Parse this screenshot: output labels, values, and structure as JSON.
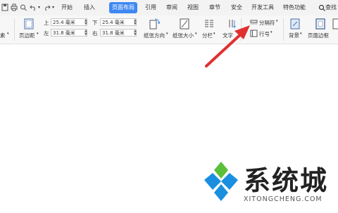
{
  "menu": {
    "tabs": [
      "开始",
      "插入",
      "页面布局",
      "引用",
      "审阅",
      "视图",
      "章节",
      "安全",
      "开发工具",
      "特色功能"
    ],
    "active_tab": "页面布局",
    "search_label": "查找"
  },
  "ribbon": {
    "margins_label": "页边距",
    "top_label": "上",
    "top_value": "25.4 毫米",
    "left_label": "左",
    "left_value": "31.8 毫米",
    "bottom_label": "下",
    "bottom_value": "25.4 毫米",
    "right_label": "右",
    "right_value": "31.8 毫米",
    "orientation_label": "纸张方向",
    "size_label": "纸张大小",
    "columns_label": "分栏",
    "textdir_label": "文字",
    "separator_label": "分隔符",
    "linenum_label": "行号",
    "background_label": "背景",
    "border_label": "页面边框",
    "cut_label": "素"
  },
  "watermark": {
    "text": "系统城",
    "url": "XITONGCHENG.COM"
  },
  "colors": {
    "accent": "#3f88f2",
    "arrow": "#e03030",
    "wm_blue": "#1a8fe0",
    "wm_green": "#5bbf3a"
  }
}
